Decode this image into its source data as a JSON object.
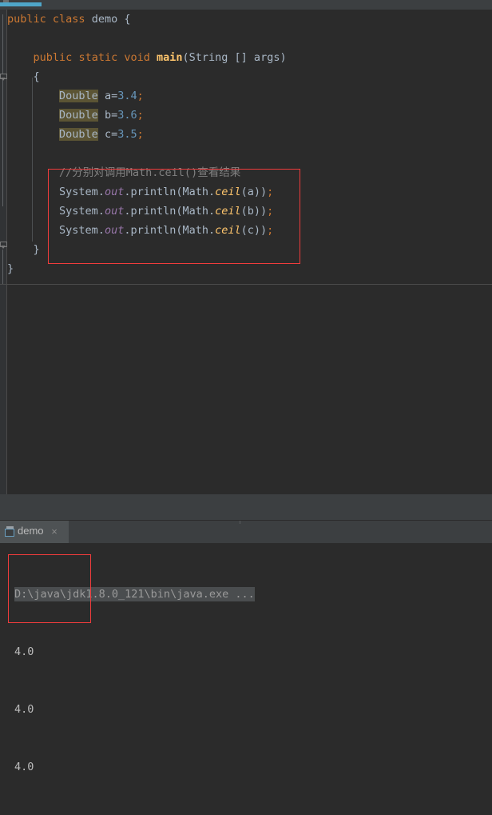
{
  "app": {
    "theme_bg": "#2b2b2b",
    "accent": "#4fa6c9",
    "annotation_color": "#f03c3c"
  },
  "editor": {
    "language": "java",
    "code_lines": [
      {
        "id": "l1",
        "tokens": [
          {
            "t": "public",
            "k": "kw"
          },
          {
            "t": " ",
            "k": "plain"
          },
          {
            "t": "class",
            "k": "kw"
          },
          {
            "t": " demo ",
            "k": "plain"
          },
          {
            "t": "{",
            "k": "plain"
          }
        ]
      },
      {
        "id": "l2",
        "tokens": []
      },
      {
        "id": "l3",
        "tokens": [
          {
            "t": "    ",
            "k": "plain"
          },
          {
            "t": "public",
            "k": "kw"
          },
          {
            "t": " ",
            "k": "plain"
          },
          {
            "t": "static",
            "k": "kw"
          },
          {
            "t": " ",
            "k": "plain"
          },
          {
            "t": "void",
            "k": "kw"
          },
          {
            "t": " ",
            "k": "plain"
          },
          {
            "t": "main",
            "k": "meth"
          },
          {
            "t": "(String [] args)",
            "k": "plain"
          }
        ]
      },
      {
        "id": "l4",
        "tokens": [
          {
            "t": "    {",
            "k": "plain"
          }
        ]
      },
      {
        "id": "l5",
        "tokens": [
          {
            "t": "        ",
            "k": "plain"
          },
          {
            "t": "Double",
            "k": "plain hl"
          },
          {
            "t": " a=",
            "k": "plain"
          },
          {
            "t": "3.4",
            "k": "num"
          },
          {
            "t": ";",
            "k": "semi"
          }
        ]
      },
      {
        "id": "l6",
        "tokens": [
          {
            "t": "        ",
            "k": "plain"
          },
          {
            "t": "Double",
            "k": "plain hl"
          },
          {
            "t": " b=",
            "k": "plain"
          },
          {
            "t": "3.6",
            "k": "num"
          },
          {
            "t": ";",
            "k": "semi"
          }
        ]
      },
      {
        "id": "l7",
        "tokens": [
          {
            "t": "        ",
            "k": "plain"
          },
          {
            "t": "Double",
            "k": "plain hl"
          },
          {
            "t": " c=",
            "k": "plain"
          },
          {
            "t": "3.5",
            "k": "num"
          },
          {
            "t": ";",
            "k": "semi"
          }
        ]
      },
      {
        "id": "l8",
        "tokens": []
      },
      {
        "id": "l9",
        "tokens": [
          {
            "t": "        ",
            "k": "plain"
          },
          {
            "t": "//分别对调用Math.ceil()查看结果",
            "k": "cmt"
          }
        ]
      },
      {
        "id": "l10",
        "tokens": [
          {
            "t": "        ",
            "k": "plain"
          },
          {
            "t": "System.",
            "k": "plain"
          },
          {
            "t": "out",
            "k": "field"
          },
          {
            "t": ".println(Math.",
            "k": "plain"
          },
          {
            "t": "ceil",
            "k": "statmeth"
          },
          {
            "t": "(a))",
            "k": "plain"
          },
          {
            "t": ";",
            "k": "semi"
          }
        ]
      },
      {
        "id": "l11",
        "tokens": [
          {
            "t": "        ",
            "k": "plain"
          },
          {
            "t": "System.",
            "k": "plain"
          },
          {
            "t": "out",
            "k": "field"
          },
          {
            "t": ".println(Math.",
            "k": "plain"
          },
          {
            "t": "ceil",
            "k": "statmeth"
          },
          {
            "t": "(b))",
            "k": "plain"
          },
          {
            "t": ";",
            "k": "semi"
          }
        ]
      },
      {
        "id": "l12",
        "tokens": [
          {
            "t": "        ",
            "k": "plain"
          },
          {
            "t": "System.",
            "k": "plain"
          },
          {
            "t": "out",
            "k": "field"
          },
          {
            "t": ".println(Math.",
            "k": "plain"
          },
          {
            "t": "ceil",
            "k": "statmeth"
          },
          {
            "t": "(c))",
            "k": "plain"
          },
          {
            "t": ";",
            "k": "semi"
          }
        ]
      },
      {
        "id": "l13",
        "tokens": [
          {
            "t": "    }",
            "k": "plain"
          }
        ]
      },
      {
        "id": "l14",
        "tokens": [
          {
            "t": "}",
            "k": "plain"
          }
        ]
      }
    ]
  },
  "run_toolwindow": {
    "tab": {
      "label": "demo",
      "icon": "console-window-icon",
      "close_icon": "×"
    },
    "console": {
      "command_line": "D:\\java\\jdk1.8.0_121\\bin\\java.exe ...",
      "output_lines": [
        "4.0",
        "4.0",
        "4.0"
      ]
    }
  }
}
